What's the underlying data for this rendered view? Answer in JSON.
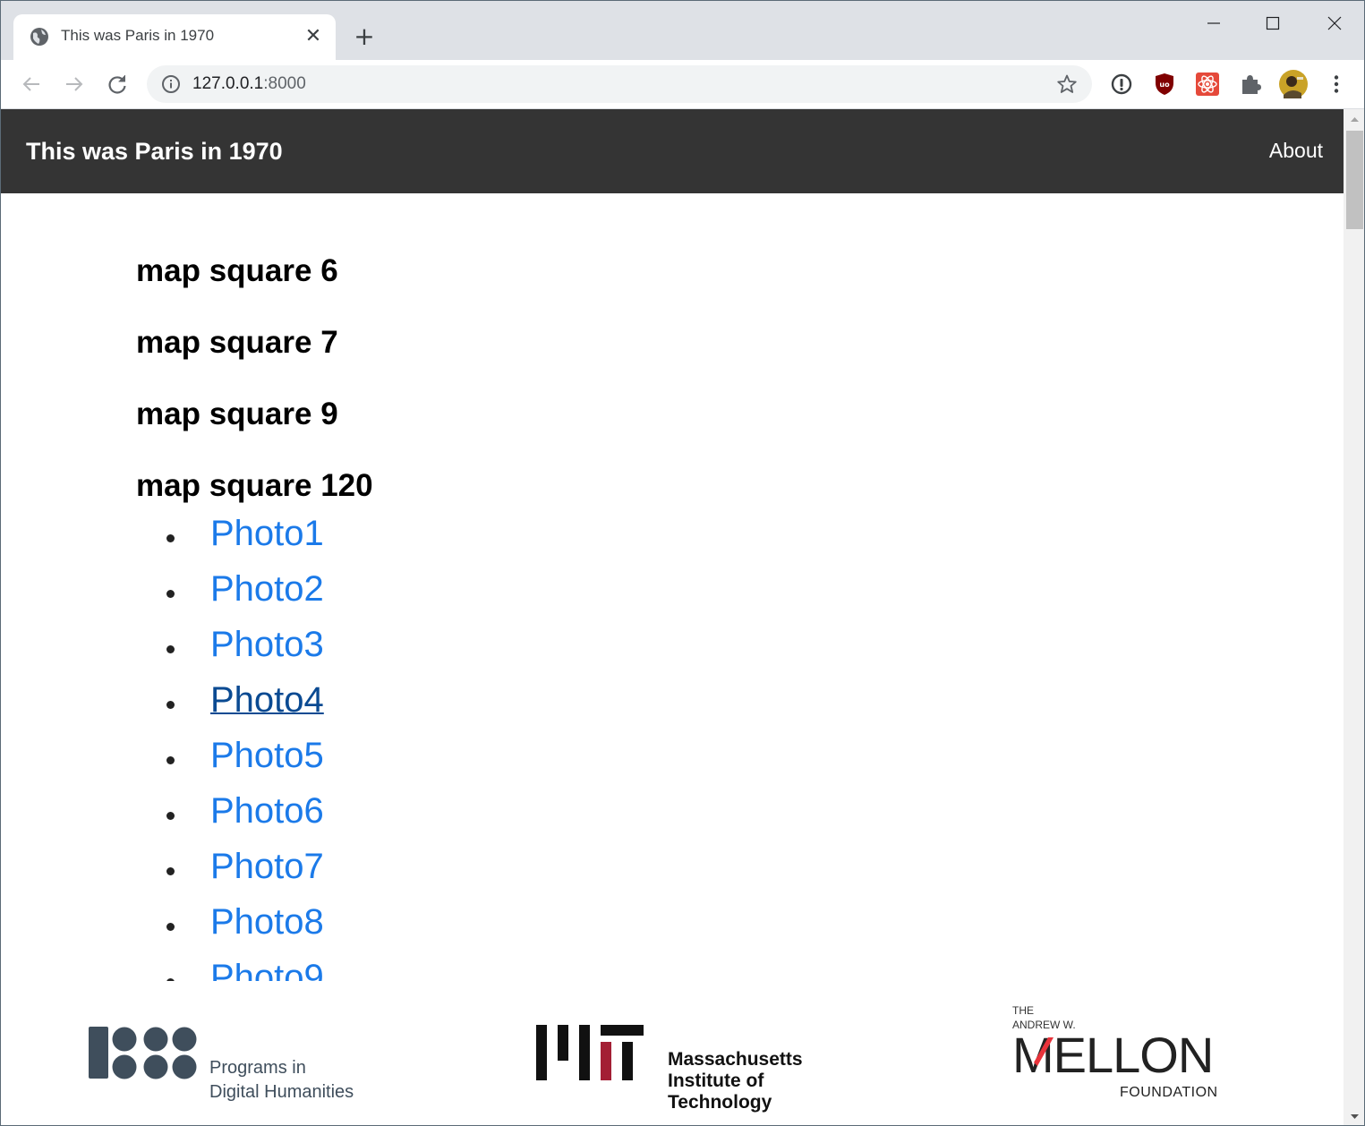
{
  "browser": {
    "tab_title": "This was Paris in 1970",
    "tab_close": "✕",
    "new_tab": "+",
    "url_host": "127.0.0.1",
    "url_port": ":8000"
  },
  "site": {
    "brand": "This was Paris in 1970",
    "about": "About"
  },
  "map_squares": [
    {
      "heading": "map square 6"
    },
    {
      "heading": "map square 7"
    },
    {
      "heading": "map square 9"
    },
    {
      "heading": "map square 120"
    }
  ],
  "photos": [
    "Photo1",
    "Photo2",
    "Photo3",
    "Photo4",
    "Photo5",
    "Photo6",
    "Photo7",
    "Photo8",
    "Photo9"
  ],
  "hovered_photo": "Photo4",
  "footer": {
    "pdh": {
      "line1": "Programs in",
      "line2": "Digital Humanities"
    },
    "mit": {
      "line1": "Massachusetts",
      "line2": "Institute of",
      "line3": "Technology"
    },
    "mellon": {
      "the": "THE",
      "andrew": "ANDREW W.",
      "word": "MELLON",
      "foundation": "FOUNDATION"
    }
  },
  "colors": {
    "navbar": "#343434",
    "link": "#1b7ae9",
    "link_hover": "#0a4a92",
    "mit_red": "#a31f34",
    "mellon_red": "#e8333b",
    "pdh_slate": "#3f4e5c"
  },
  "icons": {
    "favicon": "globe-icon",
    "back": "arrow-left-icon",
    "forward": "arrow-right-icon",
    "reload": "reload-icon",
    "info": "info-icon",
    "bookmark": "star-icon",
    "extensions": [
      "password-manager-icon",
      "ublock-icon",
      "react-devtools-icon",
      "puzzle-piece-icon",
      "avatar"
    ],
    "menu": "kebab-menu-icon"
  }
}
